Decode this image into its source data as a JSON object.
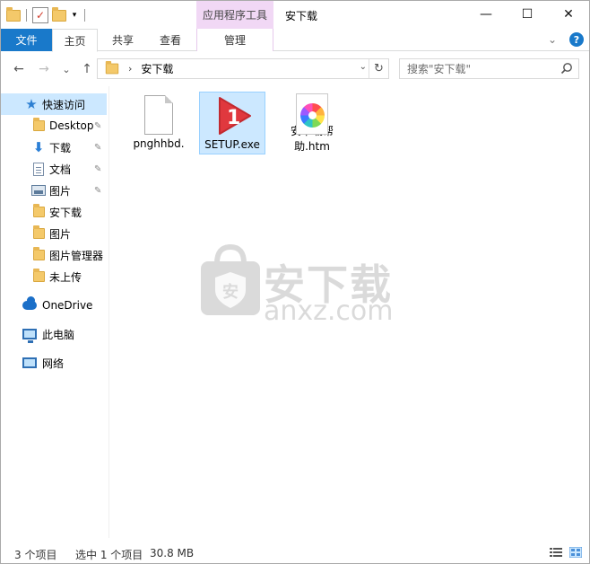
{
  "titlebar": {
    "context_tool_label": "应用程序工具",
    "window_title": "安下载",
    "qat_dropdown": "▾",
    "minimize": "—",
    "maximize": "☐",
    "close": "✕"
  },
  "ribbon": {
    "tabs": [
      {
        "label": "文件"
      },
      {
        "label": "主页"
      },
      {
        "label": "共享"
      },
      {
        "label": "查看"
      },
      {
        "label": "管理"
      }
    ],
    "expand_glyph": "⌄",
    "help_glyph": "?"
  },
  "nav": {
    "back": "←",
    "forward": "→",
    "recent": "⌄",
    "up": "↑",
    "crumb_sep": "›",
    "breadcrumb": "安下载",
    "address_dropdown": "⌄",
    "refresh": "↻",
    "search_placeholder": "搜索\"安下载\""
  },
  "sidebar": {
    "items": [
      {
        "label": "快速访问",
        "icon": "star-icon"
      },
      {
        "label": "Desktop",
        "icon": "folder-icon",
        "pinned": true
      },
      {
        "label": "下载",
        "icon": "download-icon",
        "pinned": true
      },
      {
        "label": "文档",
        "icon": "document-icon",
        "pinned": true
      },
      {
        "label": "图片",
        "icon": "pictures-icon",
        "pinned": true
      },
      {
        "label": "安下载",
        "icon": "folder-icon"
      },
      {
        "label": "图片",
        "icon": "folder-icon"
      },
      {
        "label": "图片管理器",
        "icon": "folder-icon"
      },
      {
        "label": "未上传",
        "icon": "folder-icon"
      },
      {
        "label": "OneDrive",
        "icon": "onedrive-icon"
      },
      {
        "label": "此电脑",
        "icon": "computer-icon"
      },
      {
        "label": "网络",
        "icon": "network-icon"
      }
    ],
    "pin_glyph": "📌"
  },
  "files": [
    {
      "name": "pnghhbd.",
      "type": "blank-file-icon",
      "selected": false
    },
    {
      "name": "SETUP.exe",
      "type": "setup-exe-icon",
      "selected": true
    },
    {
      "name": "安下载帮助.htm",
      "type": "htm-file-icon",
      "selected": false
    }
  ],
  "watermark": {
    "icon_glyph": "安",
    "title": "安下载",
    "subtitle": "anxz.com"
  },
  "status": {
    "item_count": "3 个项目",
    "selection": "选中 1 个项目",
    "size": "30.8 MB"
  }
}
